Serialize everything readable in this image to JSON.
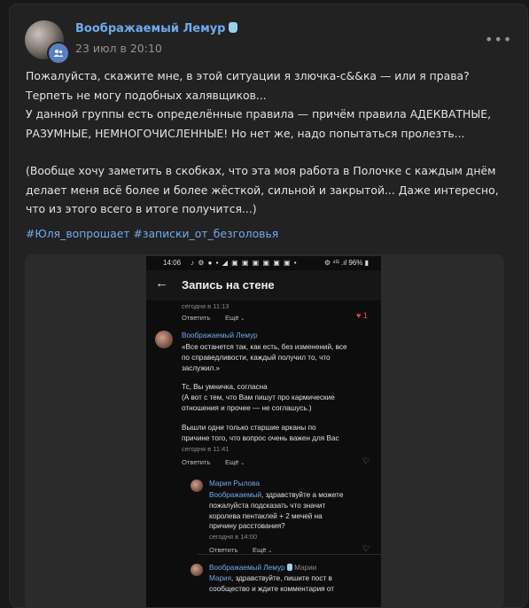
{
  "post": {
    "author": "Воображаемый Лемур",
    "date": "23 июл в 20:10",
    "more": "•••",
    "paragraphs": [
      "Пожалуйста, скажите мне, в этой ситуации я злючка-с&&ка — или я права?",
      "Терпеть не могу подобных халявщиков...",
      "У данной группы есть определённые правила — причём правила АДЕКВАТНЫЕ, РАЗУМНЫЕ, НЕМНОГОЧИСЛЕННЫЕ! Но нет же, надо попытаться пролезть...",
      "(Вообще хочу заметить в скобках, что эта моя работа в Полочке с каждым днём делает меня всё более и более жёсткой, сильной и закрытой... Даже интересно, что из этого всего в итоге получится...)"
    ],
    "tags": "#Юля_вопрошает #записки_от_безголовья"
  },
  "screenshot": {
    "status_time": "14:06",
    "status_icons": "♪ ⚙ ● ▪ ◢ ▣ ▣ ▣ ▣ ▣ ▣ •",
    "status_right": "⚙ ⁴ᴳ .ıl 96% ▮",
    "title": "Запись на стене",
    "back": "←",
    "post_time": "сегодня в 11:13",
    "reply": "Ответить",
    "more": "Ещё",
    "likes": "♥ 1",
    "c1": {
      "author": "Воображаемый Лемур",
      "lines": [
        "«Все останется так, как есть, без изменений, все",
        "по справедливости, каждый получил то, что",
        "заслужил.»",
        "",
        "Тс, Вы умничка, согласна",
        "(А вот с тем, что Вам пишут про кармические",
        "отношения и прочее — не соглашусь.)",
        "",
        "Вышли одни только старшие арканы по",
        "причине того, что вопрос очень важен для Вас"
      ],
      "time": "сегодня в 11:41"
    },
    "c2": {
      "author": "Мария Рылова",
      "mention": "Воображаемый",
      "first_line_rest": ", здравствуйте а можете",
      "lines": [
        "пожалуйста подсказать что значит",
        "королева пентаклей + 2 мечей на",
        "причину расстования?"
      ],
      "time": "сегодня в 14:00"
    },
    "c3": {
      "author": "Воображаемый Лемур",
      "to": "Марии",
      "mention": "Мария",
      "first_line_rest": ", здравствуйте, пишите пост в",
      "line2": "сообщество и ждите комментария от"
    },
    "heart_outline": "♡"
  }
}
